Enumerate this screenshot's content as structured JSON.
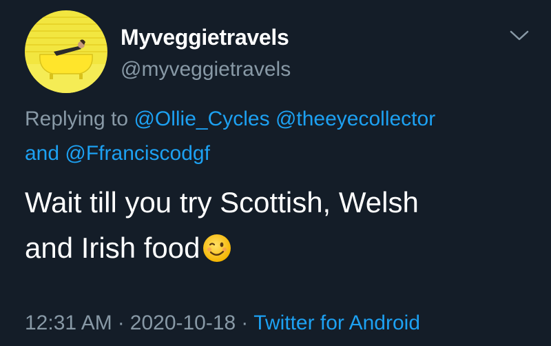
{
  "author": {
    "display_name": "Myveggietravels",
    "handle": "@myveggietravels",
    "avatar_icon": "avatar-photo-yellow-bathtub"
  },
  "reply": {
    "prefix": "Replying to",
    "mention1": "@Ollie_Cycles",
    "mention2": "@theeyecollector",
    "joiner": "and",
    "mention3": "@Ffranciscodgf"
  },
  "body": {
    "line1": "Wait till you try Scottish, Welsh",
    "line2": "and Irish food",
    "emoji_icon": "winking-face-emoji"
  },
  "meta": {
    "time": "12:31 AM",
    "separator": "·",
    "date": "2020-10-18",
    "source": "Twitter for Android"
  },
  "menu": {
    "icon": "chevron-down-icon"
  },
  "colors": {
    "background": "#141d28",
    "link": "#1da1f2",
    "secondary_text": "#8899a6",
    "primary_text": "#ffffff"
  }
}
